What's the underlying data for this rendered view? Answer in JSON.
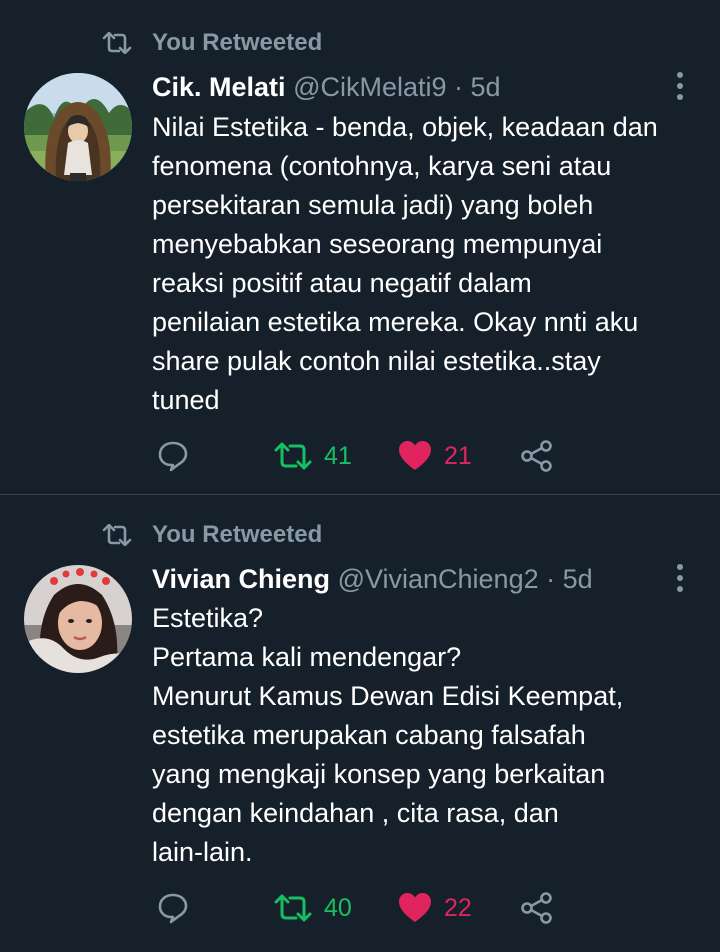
{
  "tweets": [
    {
      "retweet_label": "You Retweeted",
      "name": "Cik. Melati",
      "handle": "@CikMelati9",
      "time": "· 5d",
      "lines": [
        "Nilai Estetika - benda, objek, keadaan dan",
        "fenomena (contohnya, karya seni atau",
        "persekitaran semula jadi) yang boleh",
        "menyebabkan seseorang mempunyai",
        "reaksi positif atau negatif dalam",
        "penilaian estetika mereka. Okay nnti aku",
        "share pulak contoh nilai estetika..stay",
        "tuned"
      ],
      "retweets": "41",
      "likes": "21"
    },
    {
      "retweet_label": "You Retweeted",
      "name": "Vivian Chieng",
      "handle": "@VivianChieng2",
      "time": "· 5d",
      "lines": [
        "Estetika?",
        "Pertama kali mendengar?",
        "Menurut Kamus Dewan Edisi Keempat,",
        "estetika merupakan cabang falsafah",
        "yang mengkaji konsep yang berkaitan",
        "dengan keindahan , cita rasa, dan",
        "lain-lain."
      ],
      "retweets": "40",
      "likes": "22"
    }
  ],
  "icons": {
    "retweet": "retweet-icon",
    "reply": "reply-icon",
    "like": "heart-icon",
    "share": "share-icon",
    "more": "more-icon"
  },
  "colors": {
    "background": "#15202b",
    "secondary_text": "#8899a6",
    "retweet_active": "#17bf63",
    "like_active": "#e0245e",
    "divider": "#38444d"
  }
}
